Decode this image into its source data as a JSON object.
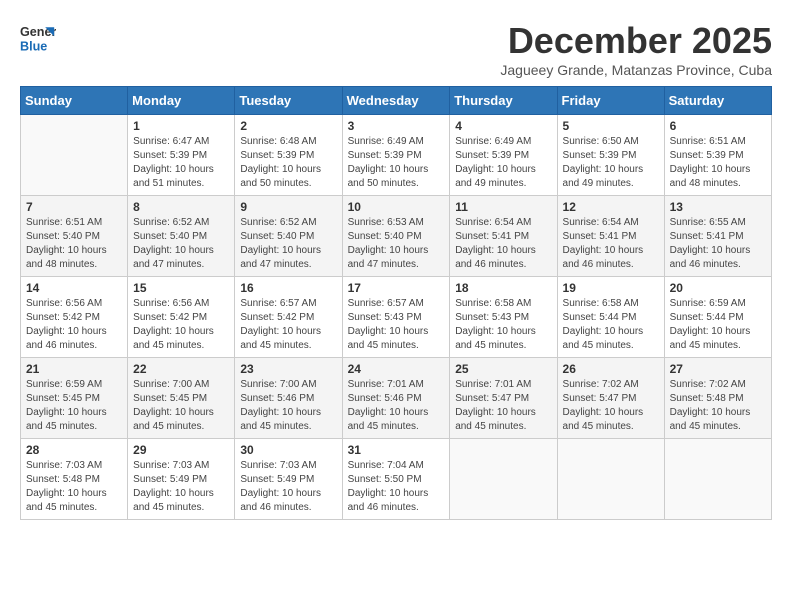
{
  "logo": {
    "line1": "General",
    "line2": "Blue"
  },
  "title": "December 2025",
  "subtitle": "Jagueey Grande, Matanzas Province, Cuba",
  "weekdays": [
    "Sunday",
    "Monday",
    "Tuesday",
    "Wednesday",
    "Thursday",
    "Friday",
    "Saturday"
  ],
  "weeks": [
    [
      {
        "day": "",
        "sunrise": "",
        "sunset": "",
        "daylight": ""
      },
      {
        "day": "1",
        "sunrise": "Sunrise: 6:47 AM",
        "sunset": "Sunset: 5:39 PM",
        "daylight": "Daylight: 10 hours and 51 minutes."
      },
      {
        "day": "2",
        "sunrise": "Sunrise: 6:48 AM",
        "sunset": "Sunset: 5:39 PM",
        "daylight": "Daylight: 10 hours and 50 minutes."
      },
      {
        "day": "3",
        "sunrise": "Sunrise: 6:49 AM",
        "sunset": "Sunset: 5:39 PM",
        "daylight": "Daylight: 10 hours and 50 minutes."
      },
      {
        "day": "4",
        "sunrise": "Sunrise: 6:49 AM",
        "sunset": "Sunset: 5:39 PM",
        "daylight": "Daylight: 10 hours and 49 minutes."
      },
      {
        "day": "5",
        "sunrise": "Sunrise: 6:50 AM",
        "sunset": "Sunset: 5:39 PM",
        "daylight": "Daylight: 10 hours and 49 minutes."
      },
      {
        "day": "6",
        "sunrise": "Sunrise: 6:51 AM",
        "sunset": "Sunset: 5:39 PM",
        "daylight": "Daylight: 10 hours and 48 minutes."
      }
    ],
    [
      {
        "day": "7",
        "sunrise": "Sunrise: 6:51 AM",
        "sunset": "Sunset: 5:40 PM",
        "daylight": "Daylight: 10 hours and 48 minutes."
      },
      {
        "day": "8",
        "sunrise": "Sunrise: 6:52 AM",
        "sunset": "Sunset: 5:40 PM",
        "daylight": "Daylight: 10 hours and 47 minutes."
      },
      {
        "day": "9",
        "sunrise": "Sunrise: 6:52 AM",
        "sunset": "Sunset: 5:40 PM",
        "daylight": "Daylight: 10 hours and 47 minutes."
      },
      {
        "day": "10",
        "sunrise": "Sunrise: 6:53 AM",
        "sunset": "Sunset: 5:40 PM",
        "daylight": "Daylight: 10 hours and 47 minutes."
      },
      {
        "day": "11",
        "sunrise": "Sunrise: 6:54 AM",
        "sunset": "Sunset: 5:41 PM",
        "daylight": "Daylight: 10 hours and 46 minutes."
      },
      {
        "day": "12",
        "sunrise": "Sunrise: 6:54 AM",
        "sunset": "Sunset: 5:41 PM",
        "daylight": "Daylight: 10 hours and 46 minutes."
      },
      {
        "day": "13",
        "sunrise": "Sunrise: 6:55 AM",
        "sunset": "Sunset: 5:41 PM",
        "daylight": "Daylight: 10 hours and 46 minutes."
      }
    ],
    [
      {
        "day": "14",
        "sunrise": "Sunrise: 6:56 AM",
        "sunset": "Sunset: 5:42 PM",
        "daylight": "Daylight: 10 hours and 46 minutes."
      },
      {
        "day": "15",
        "sunrise": "Sunrise: 6:56 AM",
        "sunset": "Sunset: 5:42 PM",
        "daylight": "Daylight: 10 hours and 45 minutes."
      },
      {
        "day": "16",
        "sunrise": "Sunrise: 6:57 AM",
        "sunset": "Sunset: 5:42 PM",
        "daylight": "Daylight: 10 hours and 45 minutes."
      },
      {
        "day": "17",
        "sunrise": "Sunrise: 6:57 AM",
        "sunset": "Sunset: 5:43 PM",
        "daylight": "Daylight: 10 hours and 45 minutes."
      },
      {
        "day": "18",
        "sunrise": "Sunrise: 6:58 AM",
        "sunset": "Sunset: 5:43 PM",
        "daylight": "Daylight: 10 hours and 45 minutes."
      },
      {
        "day": "19",
        "sunrise": "Sunrise: 6:58 AM",
        "sunset": "Sunset: 5:44 PM",
        "daylight": "Daylight: 10 hours and 45 minutes."
      },
      {
        "day": "20",
        "sunrise": "Sunrise: 6:59 AM",
        "sunset": "Sunset: 5:44 PM",
        "daylight": "Daylight: 10 hours and 45 minutes."
      }
    ],
    [
      {
        "day": "21",
        "sunrise": "Sunrise: 6:59 AM",
        "sunset": "Sunset: 5:45 PM",
        "daylight": "Daylight: 10 hours and 45 minutes."
      },
      {
        "day": "22",
        "sunrise": "Sunrise: 7:00 AM",
        "sunset": "Sunset: 5:45 PM",
        "daylight": "Daylight: 10 hours and 45 minutes."
      },
      {
        "day": "23",
        "sunrise": "Sunrise: 7:00 AM",
        "sunset": "Sunset: 5:46 PM",
        "daylight": "Daylight: 10 hours and 45 minutes."
      },
      {
        "day": "24",
        "sunrise": "Sunrise: 7:01 AM",
        "sunset": "Sunset: 5:46 PM",
        "daylight": "Daylight: 10 hours and 45 minutes."
      },
      {
        "day": "25",
        "sunrise": "Sunrise: 7:01 AM",
        "sunset": "Sunset: 5:47 PM",
        "daylight": "Daylight: 10 hours and 45 minutes."
      },
      {
        "day": "26",
        "sunrise": "Sunrise: 7:02 AM",
        "sunset": "Sunset: 5:47 PM",
        "daylight": "Daylight: 10 hours and 45 minutes."
      },
      {
        "day": "27",
        "sunrise": "Sunrise: 7:02 AM",
        "sunset": "Sunset: 5:48 PM",
        "daylight": "Daylight: 10 hours and 45 minutes."
      }
    ],
    [
      {
        "day": "28",
        "sunrise": "Sunrise: 7:03 AM",
        "sunset": "Sunset: 5:48 PM",
        "daylight": "Daylight: 10 hours and 45 minutes."
      },
      {
        "day": "29",
        "sunrise": "Sunrise: 7:03 AM",
        "sunset": "Sunset: 5:49 PM",
        "daylight": "Daylight: 10 hours and 45 minutes."
      },
      {
        "day": "30",
        "sunrise": "Sunrise: 7:03 AM",
        "sunset": "Sunset: 5:49 PM",
        "daylight": "Daylight: 10 hours and 46 minutes."
      },
      {
        "day": "31",
        "sunrise": "Sunrise: 7:04 AM",
        "sunset": "Sunset: 5:50 PM",
        "daylight": "Daylight: 10 hours and 46 minutes."
      },
      {
        "day": "",
        "sunrise": "",
        "sunset": "",
        "daylight": ""
      },
      {
        "day": "",
        "sunrise": "",
        "sunset": "",
        "daylight": ""
      },
      {
        "day": "",
        "sunrise": "",
        "sunset": "",
        "daylight": ""
      }
    ]
  ]
}
